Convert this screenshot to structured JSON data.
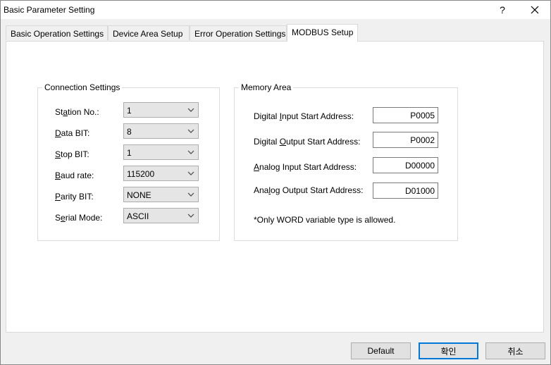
{
  "window": {
    "title": "Basic Parameter Setting",
    "help_label": "?"
  },
  "tabs": [
    {
      "label": "Basic Operation Settings"
    },
    {
      "label": "Device Area Setup"
    },
    {
      "label": "Error Operation Settings"
    },
    {
      "label": "MODBUS Setup"
    }
  ],
  "connection": {
    "title": "Connection Settings",
    "station": {
      "pre": "St",
      "key": "a",
      "post": "tion No.:",
      "value": "1"
    },
    "data_bit": {
      "pre": "",
      "key": "D",
      "post": "ata BIT:",
      "value": "8"
    },
    "stop_bit": {
      "pre": "",
      "key": "S",
      "post": "top BIT:",
      "value": "1"
    },
    "baud": {
      "pre": "",
      "key": "B",
      "post": "aud rate:",
      "value": "115200"
    },
    "parity": {
      "pre": "",
      "key": "P",
      "post": "arity BIT:",
      "value": "NONE"
    },
    "serial": {
      "pre": "S",
      "key": "e",
      "post": "rial Mode:",
      "value": "ASCII"
    }
  },
  "memory": {
    "title": "Memory Area",
    "di": {
      "pre": "Digital ",
      "key": "I",
      "post": "nput Start Address:",
      "value": "P0005"
    },
    "do": {
      "pre": "Digital ",
      "key": "O",
      "post": "utput Start Address:",
      "value": "P0002"
    },
    "ai": {
      "pre": "",
      "key": "A",
      "post": "nalog Input Start Address:",
      "value": "D00000"
    },
    "ao": {
      "pre": "Ana",
      "key": "l",
      "post": "og Output Start Address:",
      "value": "D01000"
    },
    "note": "*Only WORD variable type is allowed."
  },
  "buttons": {
    "default": "Default",
    "ok": "확인",
    "cancel": "취소"
  }
}
